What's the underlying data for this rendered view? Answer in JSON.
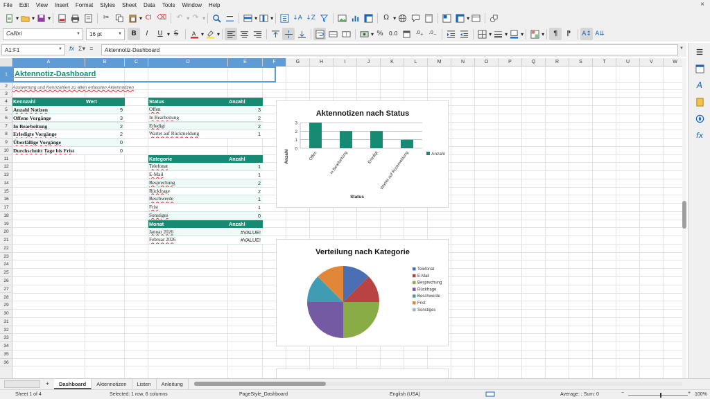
{
  "menu": [
    "File",
    "Edit",
    "View",
    "Insert",
    "Format",
    "Styles",
    "Sheet",
    "Data",
    "Tools",
    "Window",
    "Help"
  ],
  "menu_close": "×",
  "toolbar2": {
    "font_name": "Calibri",
    "font_size": "16 pt"
  },
  "formula_bar": {
    "name_box": "A1:F1",
    "content": "Aktennotiz-Dashboard"
  },
  "columns": [
    "A",
    "B",
    "C",
    "D",
    "E",
    "F",
    "G",
    "H",
    "I",
    "J",
    "K",
    "L",
    "M",
    "N",
    "O",
    "P",
    "Q",
    "R",
    "S",
    "T",
    "U",
    "V",
    "W"
  ],
  "rows": [
    "1",
    "2",
    "3",
    "4",
    "5",
    "6",
    "7",
    "8",
    "9",
    "10",
    "11",
    "12",
    "13",
    "14",
    "15",
    "16",
    "17",
    "18",
    "19",
    "20",
    "21",
    "22",
    "23",
    "24",
    "25",
    "26",
    "27",
    "28",
    "29",
    "30",
    "31",
    "32",
    "33",
    "34",
    "35",
    "36"
  ],
  "sheet": {
    "title": "Aktennotiz-Dashboard",
    "subtitle": "Auswertung und Kennzahlen zu allen erfassten Aktennotizen",
    "kpi": {
      "header": [
        "Kennzahl",
        "Wert"
      ],
      "rows": [
        [
          "Anzahl Notizen",
          "9"
        ],
        [
          "Offene Vorgänge",
          "3"
        ],
        [
          "In Bearbeitung",
          "2"
        ],
        [
          "Erledigte Vorgänge",
          "2"
        ],
        [
          "Überfällige Vorgänge",
          "0"
        ],
        [
          "Durchschnitt Tage bis Frist",
          "0"
        ]
      ]
    },
    "status_table": {
      "header": [
        "Status",
        "Anzahl"
      ],
      "rows": [
        [
          "Offen",
          "3"
        ],
        [
          "In Bearbeitung",
          "2"
        ],
        [
          "Erledigt",
          "2"
        ],
        [
          "Wartet auf Rückmeldung",
          "1"
        ]
      ]
    },
    "kategorie_table": {
      "header": [
        "Kategorie",
        "Anzahl"
      ],
      "rows": [
        [
          "Telefonat",
          "1"
        ],
        [
          "E-Mail",
          "1"
        ],
        [
          "Besprechung",
          "2"
        ],
        [
          "Rückfrage",
          "2"
        ],
        [
          "Beschwerde",
          "1"
        ],
        [
          "Frist",
          "1"
        ],
        [
          "Sonstiges",
          "0"
        ]
      ]
    },
    "monat_table": {
      "header": [
        "Monat",
        "Anzahl"
      ],
      "rows": [
        [
          "Januar 2026",
          "#VALUE!"
        ],
        [
          "Februar 2026",
          "#VALUE!"
        ]
      ]
    }
  },
  "chart_data": [
    {
      "type": "bar",
      "title": "Aktennotizen nach Status",
      "xlabel": "Status",
      "ylabel": "Anzahl",
      "categories": [
        "Offen",
        "In Bearbeitung",
        "Erledigt",
        "Wartet auf Rückmeldung"
      ],
      "series": [
        {
          "name": "Anzahl",
          "values": [
            3,
            2,
            2,
            1
          ]
        }
      ],
      "ylim": [
        0,
        3
      ],
      "yticks": [
        "0",
        "1",
        "2",
        "3"
      ],
      "grid": true,
      "legend": "right",
      "color": "#178a74"
    },
    {
      "type": "pie",
      "title": "Verteilung nach Kategorie",
      "categories": [
        "Telefonat",
        "E-Mail",
        "Besprechung",
        "Rückfrage",
        "Beschwerde",
        "Frist",
        "Sonstiges"
      ],
      "values": [
        1,
        1,
        2,
        2,
        1,
        1,
        0
      ],
      "colors": [
        "#4a6fb5",
        "#b94343",
        "#8aac47",
        "#7459a3",
        "#3f9cb3",
        "#e2873a",
        "#9ab3dc"
      ],
      "legend": "right"
    }
  ],
  "tabs": [
    "Dashboard",
    "Aktennotizen",
    "Listen",
    "Anleitung"
  ],
  "active_tab": "Dashboard",
  "tab_add": "+",
  "status_bar": {
    "sheet": "Sheet 1 of 4",
    "selection": "Selected: 1 row, 6 columns",
    "page_style": "PageStyle_Dashboard",
    "language": "English (USA)",
    "summary": "Average: ; Sum: 0",
    "zoom": "100%",
    "zoom_minus": "−",
    "zoom_plus": "+"
  },
  "toolbar1": {
    "clone_label": "Cl"
  }
}
